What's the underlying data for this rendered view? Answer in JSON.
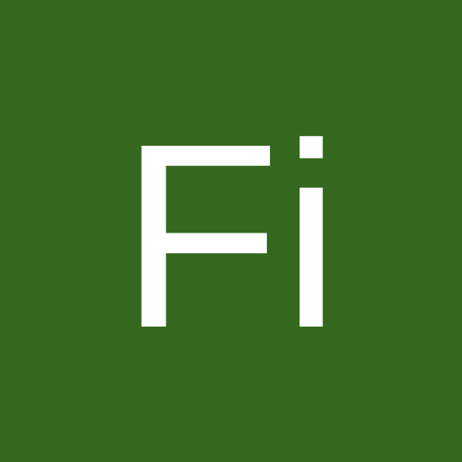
{
  "avatar": {
    "initials": "Fi",
    "background_color": "#35681f",
    "text_color": "#ffffff"
  }
}
